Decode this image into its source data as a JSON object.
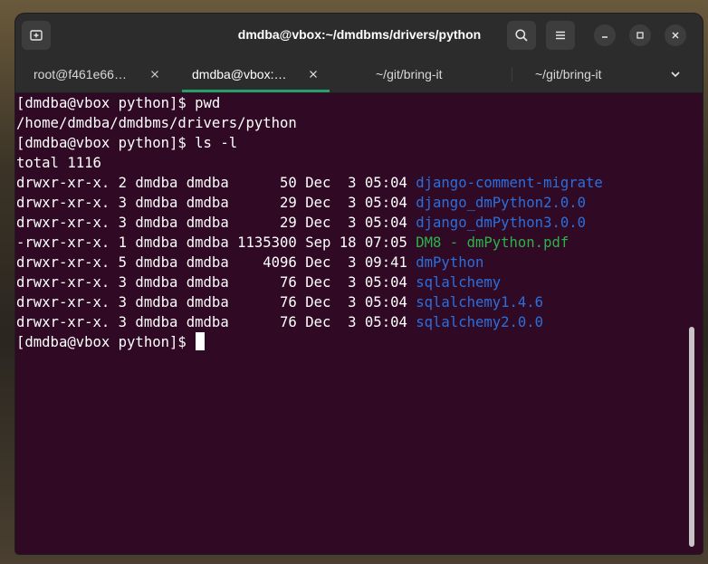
{
  "window": {
    "title": "dmdba@vbox:~/dmdbms/drivers/python"
  },
  "tabs": [
    {
      "label": "root@f461e66…",
      "active": false
    },
    {
      "label": "dmdba@vbox:…",
      "active": true
    },
    {
      "label": "~/git/bring-it",
      "active": false
    },
    {
      "label": "~/git/bring-it",
      "active": false
    }
  ],
  "icons": {
    "new_tab": "new-tab-icon",
    "search": "search-icon",
    "menu": "hamburger-menu-icon",
    "minimize": "minimize-icon",
    "maximize": "maximize-icon",
    "close": "close-icon",
    "tabs_overflow": "chevron-down-icon"
  },
  "colors": {
    "terminal_bg": "#300a24",
    "dir": "#2a6fde",
    "file_pdf": "#2bb24a",
    "accent": "#2a9d6e"
  },
  "terminal": {
    "lines": [
      {
        "text": "[dmdba@vbox python]$ pwd"
      },
      {
        "text": "/home/dmdba/dmdbms/drivers/python"
      },
      {
        "text": "[dmdba@vbox python]$ ls -l"
      },
      {
        "text": "total 1116"
      },
      {
        "text": "drwxr-xr-x. 2 dmdba dmdba      50 Dec  3 05:04 ",
        "name": "django-comment-migrate",
        "color": "blue"
      },
      {
        "text": "drwxr-xr-x. 3 dmdba dmdba      29 Dec  3 05:04 ",
        "name": "django_dmPython2.0.0",
        "color": "blue"
      },
      {
        "text": "drwxr-xr-x. 3 dmdba dmdba      29 Dec  3 05:04 ",
        "name": "django_dmPython3.0.0",
        "color": "blue"
      },
      {
        "text": "-rwxr-xr-x. 1 dmdba dmdba 1135300 Sep 18 07:05 ",
        "name": "DM8 - dmPython.pdf",
        "color": "green"
      },
      {
        "text": "drwxr-xr-x. 5 dmdba dmdba    4096 Dec  3 09:41 ",
        "name": "dmPython",
        "color": "blue"
      },
      {
        "text": "drwxr-xr-x. 3 dmdba dmdba      76 Dec  3 05:04 ",
        "name": "sqlalchemy",
        "color": "blue"
      },
      {
        "text": "drwxr-xr-x. 3 dmdba dmdba      76 Dec  3 05:04 ",
        "name": "sqlalchemy1.4.6",
        "color": "blue"
      },
      {
        "text": "drwxr-xr-x. 3 dmdba dmdba      76 Dec  3 05:04 ",
        "name": "sqlalchemy2.0.0",
        "color": "blue"
      }
    ],
    "prompt": "[dmdba@vbox python]$ "
  }
}
